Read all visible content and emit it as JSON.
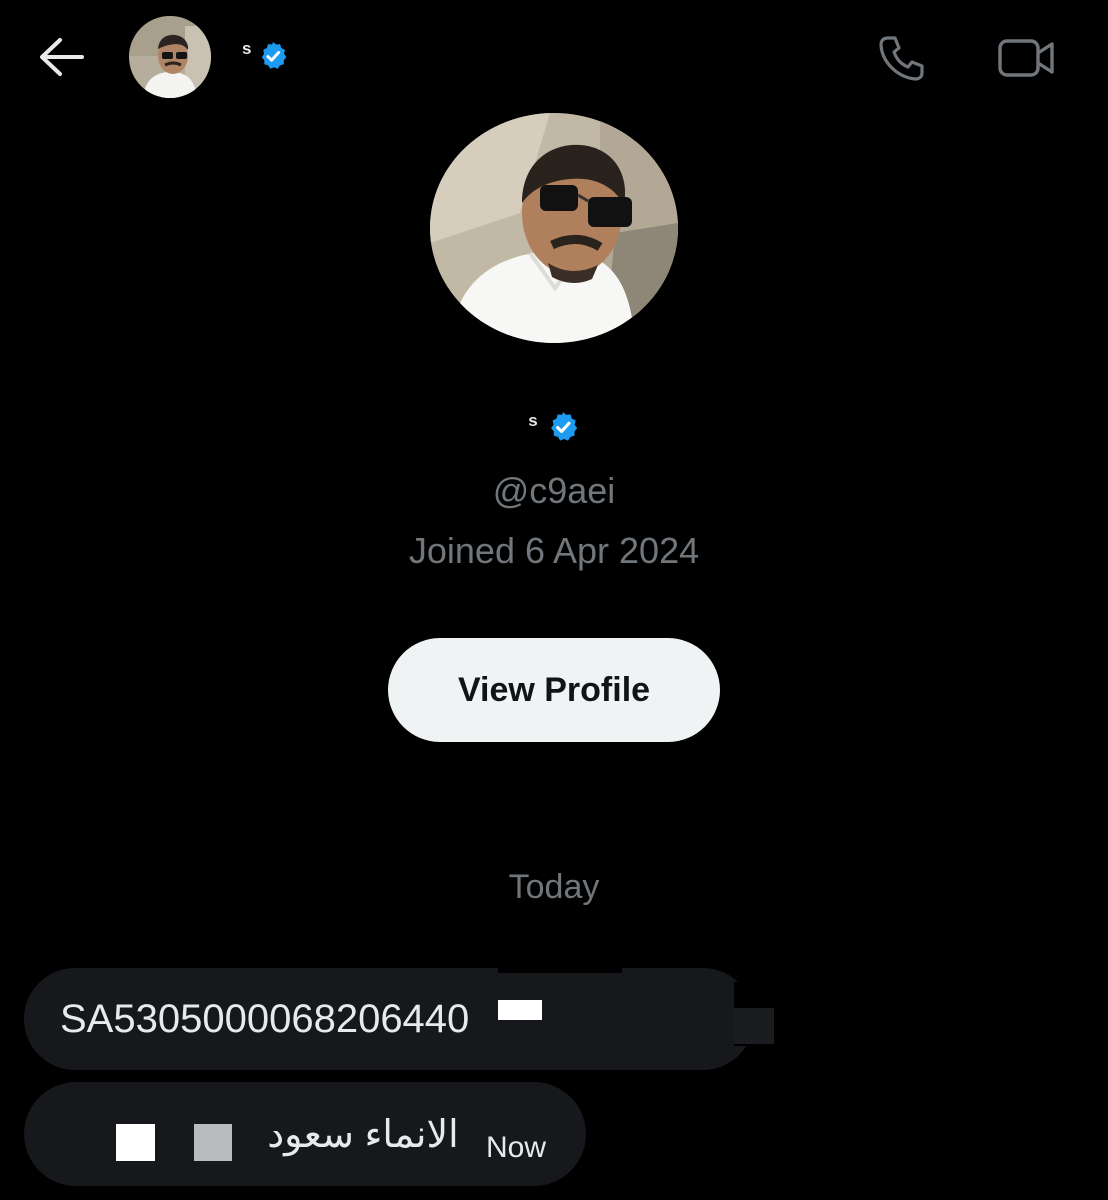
{
  "header": {
    "back_icon": "arrow-left-icon",
    "contact_name": "s",
    "verified_icon": "verified-badge-icon",
    "verified_color": "#1d9bf0",
    "call_icon": "phone-icon",
    "video_icon": "video-camera-icon"
  },
  "profile": {
    "name": "s",
    "handle": "@c9aei",
    "joined": "Joined 6 Apr 2024",
    "view_profile_label": "View Profile"
  },
  "conversation": {
    "day_label": "Today",
    "messages": [
      {
        "text": "SA5305000068206440"
      },
      {
        "text": "الانماء سعود",
        "time": "Now"
      }
    ]
  },
  "colors": {
    "background": "#000000",
    "bubble": "#16181c",
    "muted_text": "#71767b",
    "button_bg": "#eff3f4",
    "accent": "#1d9bf0"
  }
}
